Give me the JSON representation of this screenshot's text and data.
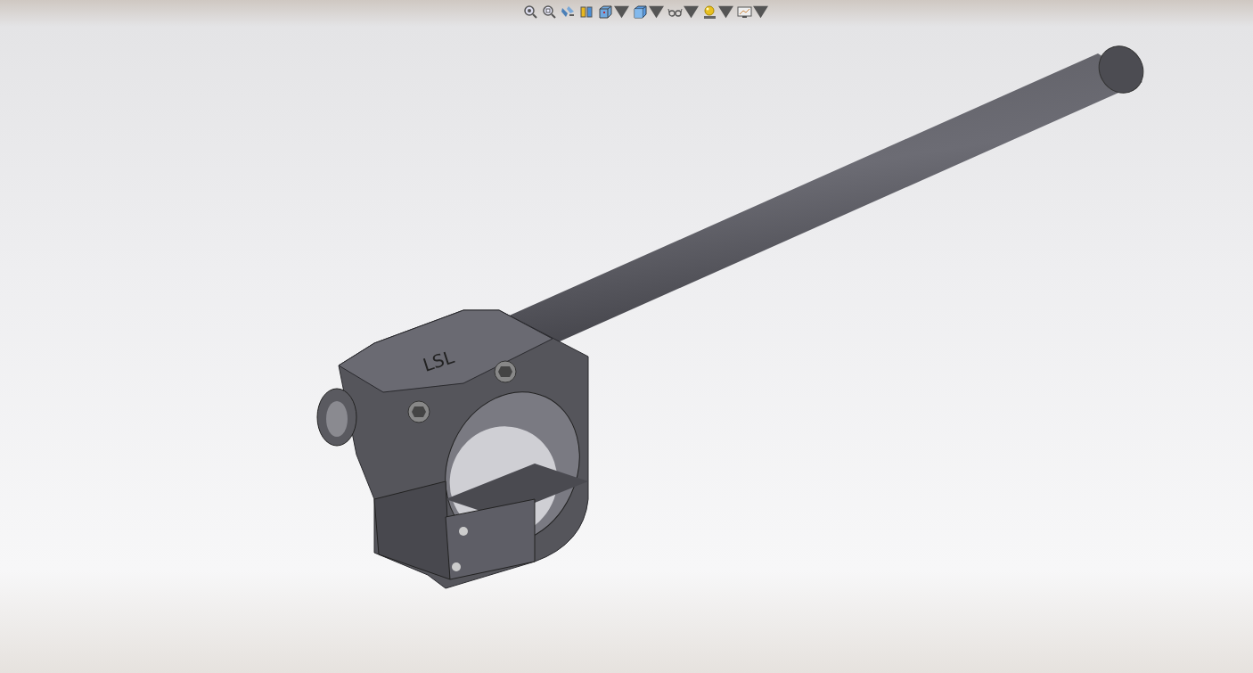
{
  "toolbar": {
    "tools": [
      {
        "kind": "zoom-fit",
        "dropdown": false
      },
      {
        "kind": "zoom-area",
        "dropdown": false
      },
      {
        "kind": "previous-view",
        "dropdown": false
      },
      {
        "kind": "section",
        "dropdown": false
      },
      {
        "kind": "orientation",
        "dropdown": true
      },
      {
        "kind": "display-style",
        "dropdown": true
      },
      {
        "kind": "hide-show",
        "dropdown": true
      },
      {
        "kind": "appearance",
        "dropdown": true
      },
      {
        "kind": "scene",
        "dropdown": true
      }
    ]
  },
  "model": {
    "engraving": "LSL"
  }
}
